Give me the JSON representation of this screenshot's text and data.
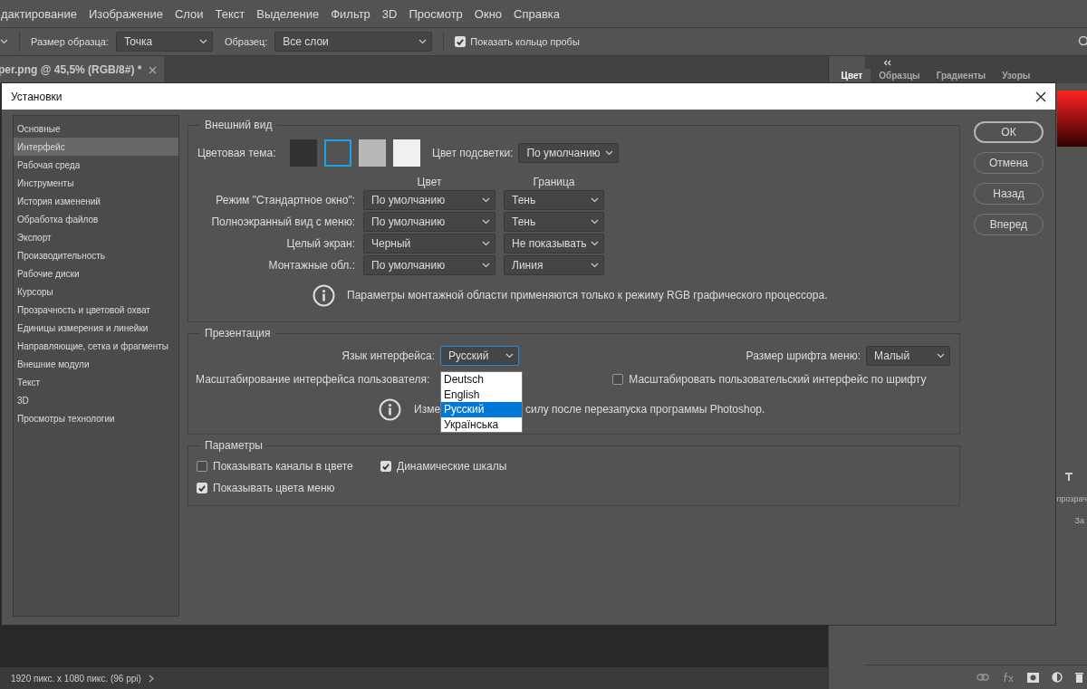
{
  "menu_bar": {
    "items": [
      "дактирование",
      "Изображение",
      "Слои",
      "Текст",
      "Выделение",
      "Фильтр",
      "3D",
      "Просмотр",
      "Окно",
      "Справка"
    ]
  },
  "options_bar": {
    "sample_size_label": "Размер образца:",
    "sample_size": "Точка",
    "sample_label": "Образец:",
    "sample": "Все слои",
    "show_ring": {
      "label": "Показать кольцо пробы",
      "checked": true
    }
  },
  "document_tab": {
    "title": "per.png @ 45,5% (RGB/8#) *"
  },
  "panel_tabs": [
    {
      "label": "Цвет",
      "selected": true
    },
    {
      "label": "Образцы",
      "selected": false
    },
    {
      "label": "Градиенты",
      "selected": false
    },
    {
      "label": "Узоры",
      "selected": false
    }
  ],
  "layers_panel": {
    "opacity_label": "прозрач",
    "fill_label": "За"
  },
  "status_bar": {
    "text": "1920 пикс. x 1080 пикс. (96 ppi)"
  },
  "dialog": {
    "title": "Установки",
    "sidebar": [
      {
        "label": "Основные",
        "selected": false
      },
      {
        "label": "Интерфейс",
        "selected": true
      },
      {
        "label": "Рабочая среда",
        "selected": false
      },
      {
        "label": "Инструменты",
        "selected": false
      },
      {
        "label": "История изменений",
        "selected": false
      },
      {
        "label": "Обработка файлов",
        "selected": false
      },
      {
        "label": "Экспорт",
        "selected": false
      },
      {
        "label": "Производительность",
        "selected": false
      },
      {
        "label": "Рабочие диски",
        "selected": false
      },
      {
        "label": "Курсоры",
        "selected": false
      },
      {
        "label": "Прозрачность и цветовой охват",
        "selected": false
      },
      {
        "label": "Единицы измерения и линейки",
        "selected": false
      },
      {
        "label": "Направляющие, сетка и фрагменты",
        "selected": false
      },
      {
        "label": "Внешние модули",
        "selected": false
      },
      {
        "label": "Текст",
        "selected": false
      },
      {
        "label": "3D",
        "selected": false
      },
      {
        "label": "Просмотры технологии",
        "selected": false
      }
    ],
    "appearance": {
      "title": "Внешний вид",
      "theme_label": "Цветовая тема:",
      "themes": [
        {
          "color": "#323232",
          "selected": false
        },
        {
          "color": "#535353",
          "selected": true
        },
        {
          "color": "#b8b8b8",
          "selected": false
        },
        {
          "color": "#f0f0f0",
          "selected": false
        }
      ],
      "highlight_label": "Цвет подсветки:",
      "highlight": "По умолчанию",
      "column_headers": [
        "Цвет",
        "Граница"
      ],
      "rows": [
        {
          "label": "Режим \"Стандартное окно\":",
          "color_setting": "По умолчанию",
          "border": "Тень"
        },
        {
          "label": "Полноэкранный вид с меню:",
          "color_setting": "По умолчанию",
          "border": "Тень"
        },
        {
          "label": "Целый экран:",
          "color_setting": "Черный",
          "border": "Не показывать"
        },
        {
          "label": "Монтажные обл.:",
          "color_setting": "По умолчанию",
          "border": "Линия"
        }
      ],
      "note": "Параметры монтажной области применяются только к режиму RGB графического процессора."
    },
    "presentation": {
      "title": "Презентация",
      "language_label": "Язык интерфейса:",
      "language": "Русский",
      "language_options": [
        {
          "label": "Deutsch",
          "selected": false
        },
        {
          "label": "English",
          "selected": false
        },
        {
          "label": "Русский",
          "selected": true
        },
        {
          "label": "Українська",
          "selected": false
        }
      ],
      "menu_font_label": "Размер шрифта меню:",
      "menu_font": "Малый",
      "scaling_label": "Масштабирование интерфейса пользователя:",
      "scale_to_font": {
        "label": "Масштабировать пользовательский интерфейс по шрифту",
        "checked": false
      },
      "note_parts": [
        "Изме",
        "силу после перезапуска программы Photoshop."
      ]
    },
    "options": {
      "title": "Параметры",
      "checkboxes": [
        {
          "label": "Показывать каналы в цвете",
          "checked": false
        },
        {
          "label": "Динамические шкалы",
          "checked": true
        },
        {
          "label": "Показывать цвета меню",
          "checked": true
        }
      ]
    },
    "buttons": [
      {
        "label": "ОК",
        "default": true
      },
      {
        "label": "Отмена",
        "default": false
      },
      {
        "label": "Назад",
        "default": false
      },
      {
        "label": "Вперед",
        "default": false
      }
    ]
  }
}
